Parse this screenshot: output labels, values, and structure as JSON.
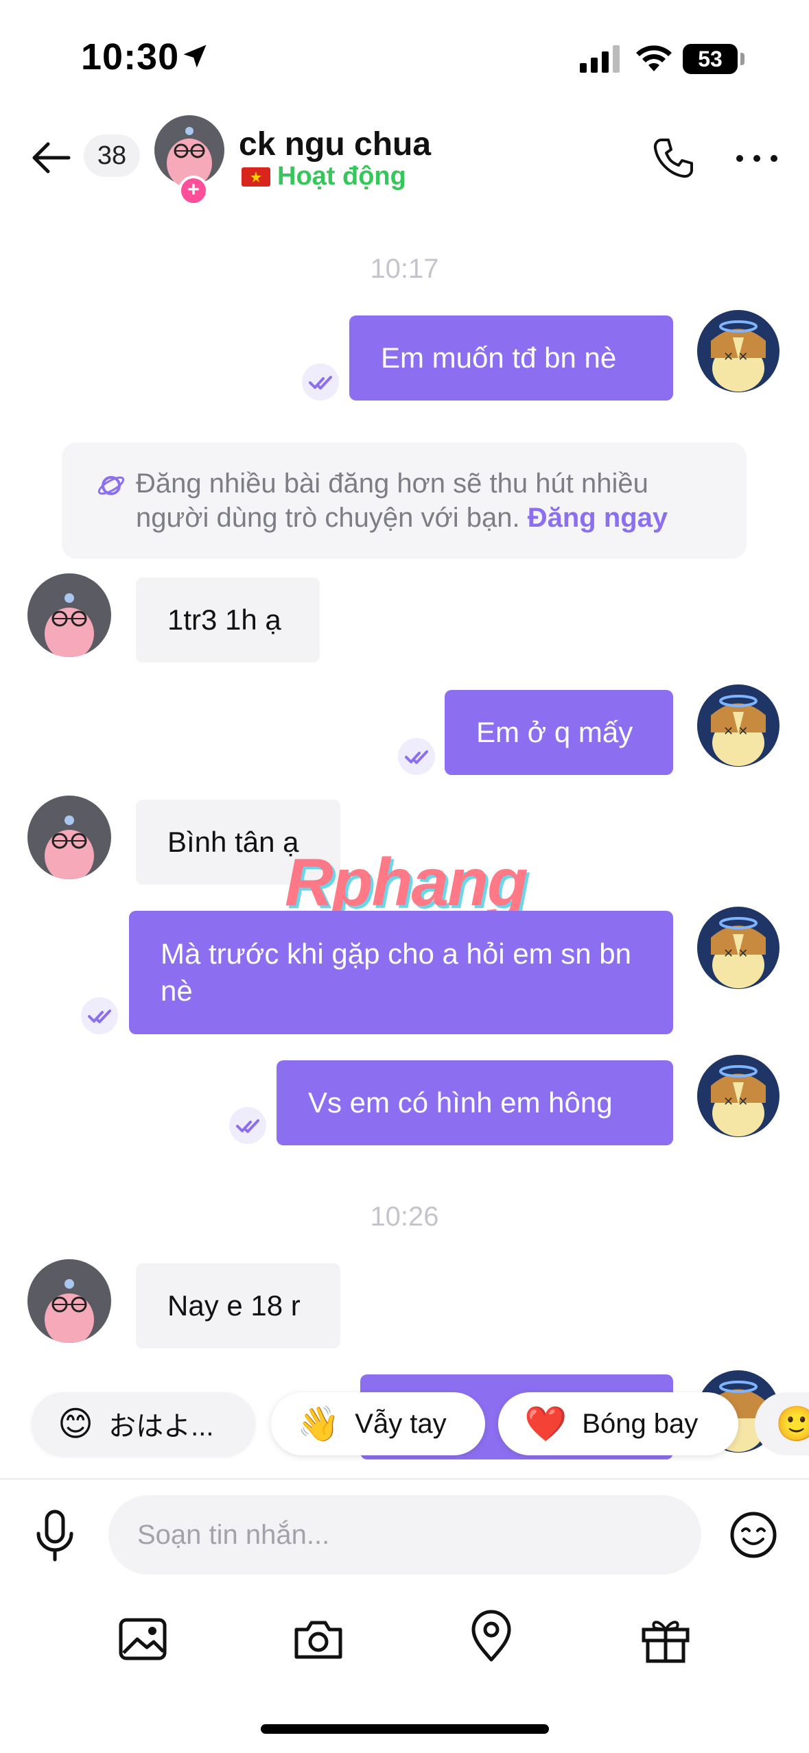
{
  "status_bar": {
    "time": "10:30",
    "battery": "53"
  },
  "header": {
    "unread_count": "38",
    "contact_name": "ck ngu chua",
    "status": "Hoạt động",
    "plus_symbol": "+"
  },
  "timestamps": [
    "10:17",
    "10:26"
  ],
  "messages": [
    {
      "from": "me",
      "text": "Em muốn tđ bn nè"
    },
    {
      "from": "other",
      "text": "1tr3 1h ạ"
    },
    {
      "from": "me",
      "text": "Em ở q mấy"
    },
    {
      "from": "other",
      "text": "Bình tân ạ"
    },
    {
      "from": "me",
      "text": "Mà trước khi gặp cho a hỏi em sn bn nè"
    },
    {
      "from": "me",
      "text": "Vs em có hình em hông"
    },
    {
      "from": "other",
      "text": "Nay e 18 r"
    }
  ],
  "notice": {
    "text": "Đăng nhiều bài đăng hơn sẽ thu hút nhiều người dùng trò chuyện với bạn.",
    "link": "Đăng ngay"
  },
  "watermark": "Rphang",
  "quick_replies": [
    {
      "emoji": "😊",
      "label": "おはよ..."
    },
    {
      "emoji": "👋",
      "label": "Vẫy tay"
    },
    {
      "emoji": "❤️",
      "label": "Bóng bay"
    }
  ],
  "composer": {
    "placeholder": "Soạn tin nhắn..."
  },
  "toolbar": [
    "image-icon",
    "camera-icon",
    "location-icon",
    "gift-icon"
  ],
  "colors": {
    "accent": "#8c6ff0",
    "online": "#35c759",
    "incoming": "#f3f3f5"
  }
}
